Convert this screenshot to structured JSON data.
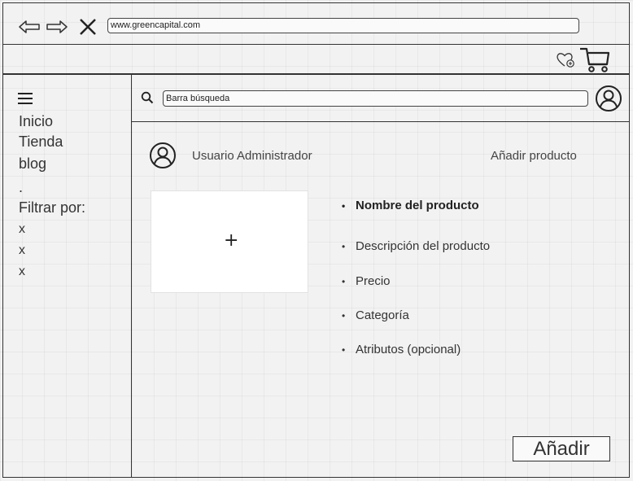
{
  "browser": {
    "url": "www.greencapital.com",
    "icons": [
      "back-arrow-icon",
      "forward-arrow-icon",
      "close-icon"
    ]
  },
  "header": {
    "icons": [
      "heart-add-icon",
      "cart-icon"
    ]
  },
  "sidebar": {
    "menu_icon": "menu-icon",
    "items": [
      {
        "label": "Inicio"
      },
      {
        "label": "Tienda"
      },
      {
        "label": "blog"
      },
      {
        "label": "."
      },
      {
        "label": "Filtrar por:"
      }
    ],
    "filters": [
      "x",
      "x",
      "x"
    ]
  },
  "search": {
    "placeholder": "Barra búsqueda",
    "icon": "search-icon",
    "profile_icon": "user-icon"
  },
  "main": {
    "admin_label": "Usuario Administrador",
    "page_title": "Añadir producto",
    "image_placeholder_symbol": "+",
    "fields": [
      {
        "label": "Nombre del producto",
        "bold": true
      },
      {
        "label": "Descripción del producto",
        "bold": false
      },
      {
        "label": "Precio",
        "bold": false
      },
      {
        "label": "Categoría",
        "bold": false
      },
      {
        "label": "Atributos (opcional)",
        "bold": false
      }
    ],
    "submit_label": "Añadir"
  }
}
